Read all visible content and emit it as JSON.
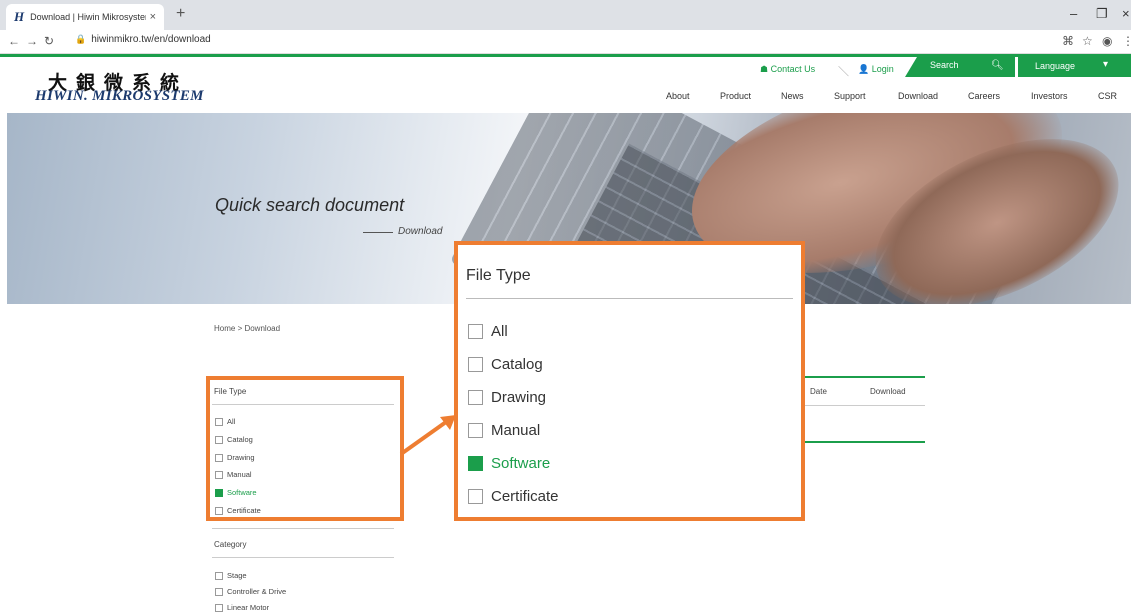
{
  "browser": {
    "tab_title": "Download | Hiwin Mikrosystem",
    "tab_favicon": "H",
    "tab_close": "×",
    "new_tab": "+",
    "url": "hiwinmikro.tw/en/download",
    "window_minimize": "–",
    "window_maximize": "❐",
    "window_close": "×"
  },
  "header": {
    "logo_cn": "大銀微系統",
    "logo_en": "HIWIN. MIKROSYSTEM",
    "contact": "Contact Us",
    "login": "Login",
    "search": "Search",
    "language": "Language",
    "nav": [
      "About",
      "Product",
      "News",
      "Support",
      "Download",
      "Careers",
      "Investors",
      "CSR"
    ]
  },
  "hero": {
    "title": "Quick search document",
    "subtitle": "Download"
  },
  "breadcrumb": "Home  >  Download",
  "filters": {
    "file_type_title": "File Type",
    "file_types": [
      {
        "label": "All",
        "checked": false
      },
      {
        "label": "Catalog",
        "checked": false
      },
      {
        "label": "Drawing",
        "checked": false
      },
      {
        "label": "Manual",
        "checked": false
      },
      {
        "label": "Software",
        "checked": true
      },
      {
        "label": "Certificate",
        "checked": false
      }
    ],
    "category_title": "Category",
    "categories": [
      "Stage",
      "Controller & Drive",
      "Linear Motor"
    ]
  },
  "table": {
    "headers": [
      "Date",
      "Download"
    ]
  },
  "colors": {
    "brand_green": "#1b9e4b",
    "highlight_orange": "#ee7d31",
    "logo_blue": "#1c3a6e"
  }
}
